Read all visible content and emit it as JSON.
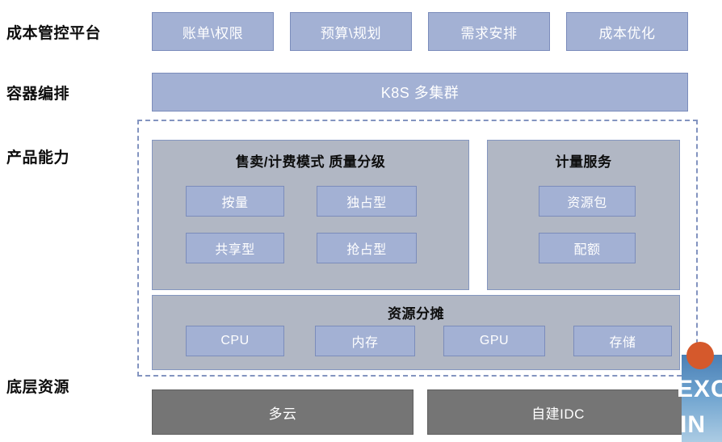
{
  "tiers": {
    "cost_platform": "成本管控平台",
    "orchestration": "容器编排",
    "product_capability": "产品能力",
    "infrastructure": "底层资源"
  },
  "cost_platform_row": {
    "boxes": [
      {
        "label": "账单\\权限"
      },
      {
        "label": "预算\\规划"
      },
      {
        "label": "需求安排"
      },
      {
        "label": "成本优化"
      }
    ]
  },
  "orchestration_row": {
    "bar_label": "K8S 多集群"
  },
  "product_capability": {
    "billing_panel": {
      "title": "售卖/计费模式 质量分级",
      "chips": [
        {
          "label": "按量"
        },
        {
          "label": "独占型"
        },
        {
          "label": "共享型"
        },
        {
          "label": "抢占型"
        }
      ]
    },
    "metering_panel": {
      "title": "计量服务",
      "chips": [
        {
          "label": "资源包"
        },
        {
          "label": "配额"
        }
      ]
    },
    "allocation_panel": {
      "title": "资源分摊",
      "chips": [
        {
          "label": "CPU"
        },
        {
          "label": "内存"
        },
        {
          "label": "GPU"
        },
        {
          "label": "存储"
        }
      ]
    }
  },
  "infrastructure_row": {
    "boxes": [
      {
        "label": "多云"
      },
      {
        "label": "自建IDC"
      }
    ]
  },
  "watermark": {
    "line1": "EXCEL",
    "line2": "IN"
  },
  "colors": {
    "blue_box_fill": "#a3b1d4",
    "blue_box_border": "#7b8cbb",
    "gray_panel_fill": "#b1b7c4",
    "gray_panel_border": "#8496bf",
    "dark_box_fill": "#757575",
    "dashed_border": "#8394c0",
    "label_text": "#0d0d0d",
    "box_text": "#ffffff",
    "background": "#ffffff"
  }
}
